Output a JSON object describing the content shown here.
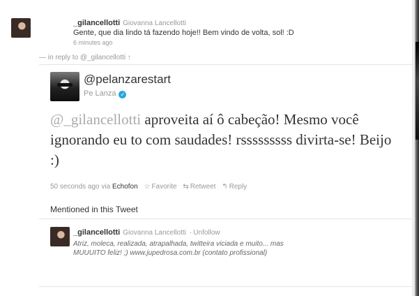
{
  "prior_tweet": {
    "username": "_gilancellotti",
    "full_name": "Giovanna Lancellotti",
    "text": "Gente, que dia lindo tá fazendo hoje!! Bem vindo de volta, sol! :D",
    "time": "6 minutes ago"
  },
  "reply_context": {
    "prefix": "— in reply to",
    "handle": "@_gilancellotti",
    "arrow": "↑"
  },
  "tweet": {
    "screen_name": "@pelanzarestart",
    "display_name": "Pe Lanza",
    "verified_glyph": "✓",
    "mention": "@_gilancellotti",
    "text_rest": " aproveita aí ô cabeção! Mesmo você ignorando eu to com saudades! rsssssssss divirta-se! Beijo :)",
    "timestamp": "50 seconds ago",
    "via_label": "via",
    "source": "Echofon",
    "actions": {
      "favorite": "Favorite",
      "retweet": "Retweet",
      "reply": "Reply"
    }
  },
  "mentioned": {
    "heading": "Mentioned in this Tweet",
    "username": "_gilancellotti",
    "full_name": "Giovanna Lancellotti",
    "separator": "·",
    "unfollow": "Unfollow",
    "bio": "Atriz, moleca, realizada, atrapalhada, twitteira viciada e muito... mas MUUUITO feliz! ;) www.jupedrosa.com.br (contato profissional)"
  },
  "icons": {
    "favorite": "star-icon",
    "retweet": "retweet-icon",
    "reply": "reply-arrow-icon",
    "verified": "verified-badge-icon"
  },
  "colors": {
    "verified": "#2aa7e0",
    "mention": "#aaaaaa"
  }
}
